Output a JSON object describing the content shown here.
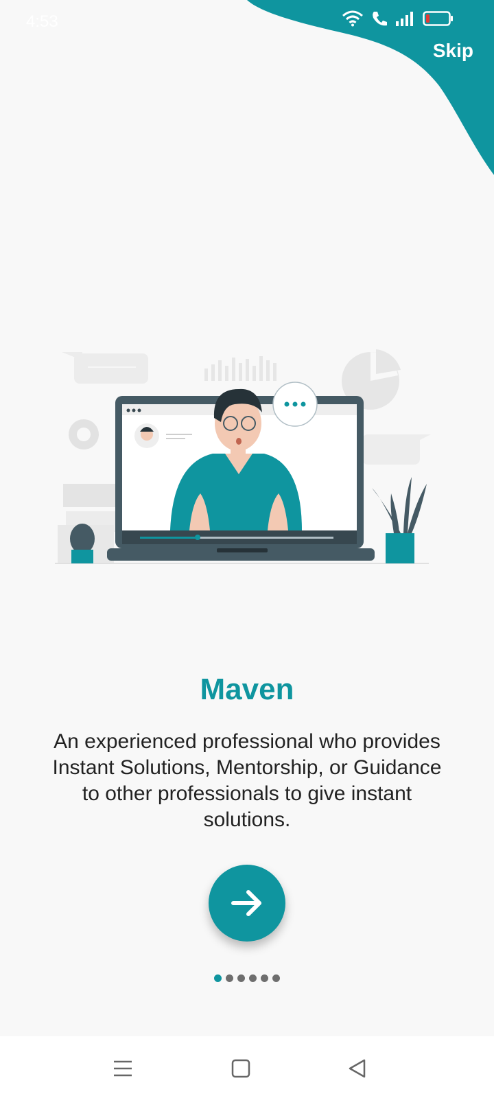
{
  "status_bar": {
    "time": "4:53"
  },
  "header": {
    "skip_label": "Skip"
  },
  "onboarding": {
    "title": "Maven",
    "description": "An experienced professional who provides Instant Solutions, Mentorship, or Guidance to other professionals to give instant solutions.",
    "current_page": 1,
    "total_pages": 6
  },
  "colors": {
    "accent": "#0f959f",
    "background": "#f8f8f8",
    "dot_inactive": "#6e6e6e"
  },
  "icons": {
    "next": "arrow-right-icon",
    "nav_menu": "menu-icon",
    "nav_home": "square-home-icon",
    "nav_back": "triangle-back-icon"
  }
}
